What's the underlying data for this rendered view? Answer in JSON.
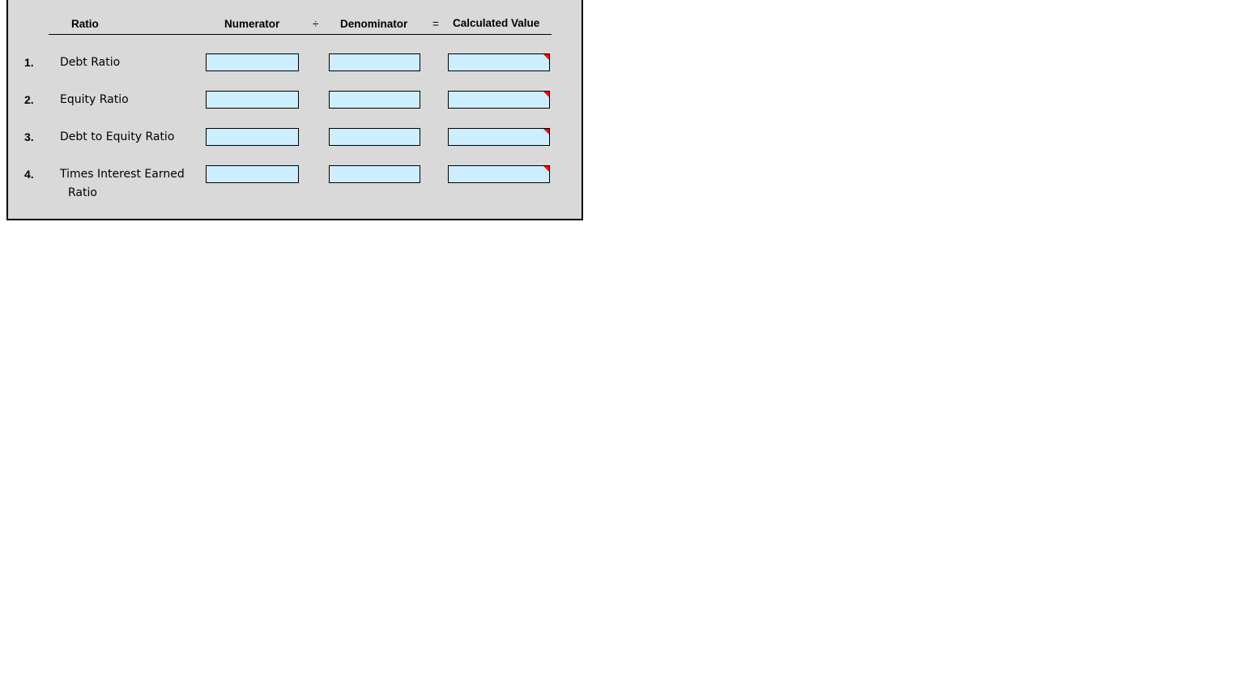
{
  "headers": {
    "ratio": "Ratio",
    "numerator": "Numerator",
    "divide": "÷",
    "denominator": "Denominator",
    "equals": "=",
    "calculated_value": "Calculated Value"
  },
  "rows": [
    {
      "number": "1.",
      "label": "Debt Ratio",
      "label_line2": "",
      "numerator": "",
      "denominator": "",
      "calculated_value": ""
    },
    {
      "number": "2.",
      "label": "Equity Ratio",
      "label_line2": "",
      "numerator": "",
      "denominator": "",
      "calculated_value": ""
    },
    {
      "number": "3.",
      "label": "Debt to Equity Ratio",
      "label_line2": "",
      "numerator": "",
      "denominator": "",
      "calculated_value": ""
    },
    {
      "number": "4.",
      "label": "Times Interest Earned",
      "label_line2": "Ratio",
      "numerator": "",
      "denominator": "",
      "calculated_value": ""
    }
  ],
  "colors": {
    "panel_bg": "#d9d9d9",
    "input_bg": "#cceeff",
    "comment_marker": "#ff0000"
  }
}
